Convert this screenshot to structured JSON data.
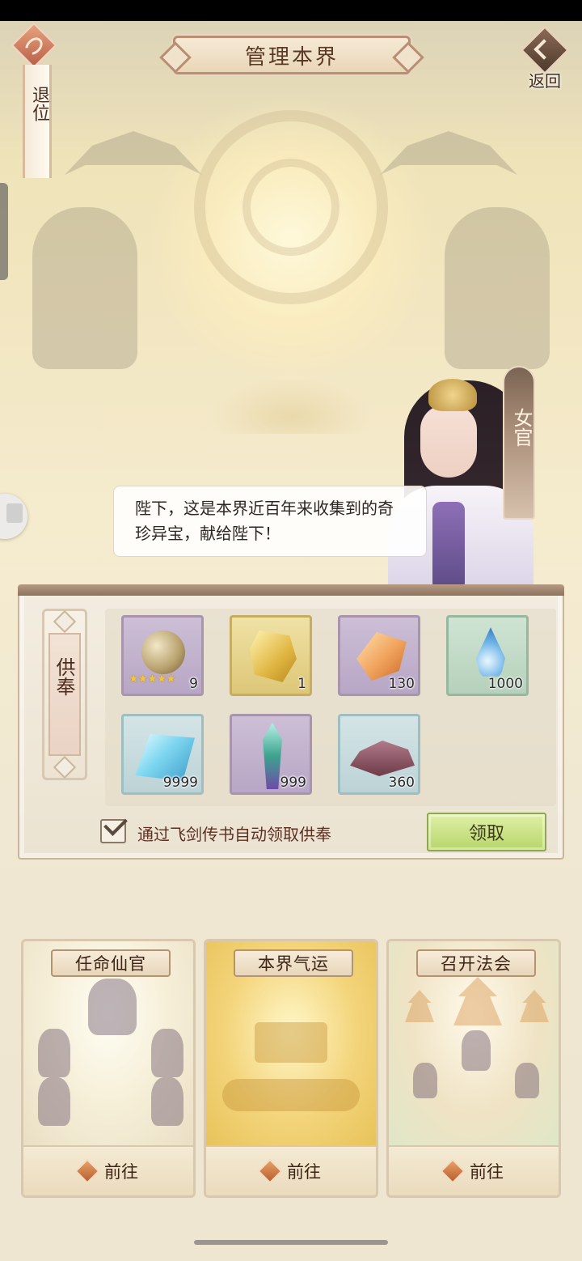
{
  "header": {
    "title": "管理本界",
    "abdicate_label": "退位",
    "back_label": "返回"
  },
  "character": {
    "badge_label": "女官",
    "dialogue": "陛下，这是本界近百年来收集到的奇珍异宝，献给陛下！"
  },
  "tribute": {
    "label": "供奉",
    "items": [
      {
        "name": "spirit-orb",
        "quantity": "9",
        "stars": "★★★★★",
        "rarity": "purple"
      },
      {
        "name": "gold-ore",
        "quantity": "1",
        "rarity": "gold"
      },
      {
        "name": "amber-stone",
        "quantity": "130",
        "rarity": "purple"
      },
      {
        "name": "water-drop",
        "quantity": "1000",
        "rarity": "green"
      },
      {
        "name": "blue-crystal",
        "quantity": "9999",
        "rarity": "blue"
      },
      {
        "name": "jade-sword",
        "quantity": "999",
        "rarity": "purple"
      },
      {
        "name": "sand-pile",
        "quantity": "360",
        "rarity": "blue"
      }
    ],
    "auto_claim_label": "通过飞剑传书自动领取供奉",
    "auto_claim_checked": true,
    "claim_button": "领取"
  },
  "cards": [
    {
      "title": "任命仙官",
      "go_label": "前往"
    },
    {
      "title": "本界气运",
      "go_label": "前往"
    },
    {
      "title": "召开法会",
      "go_label": "前往"
    }
  ],
  "colors": {
    "accent_brown": "#5b3a25",
    "claim_green": "#b8d66b",
    "go_icon_orange": "#b86030"
  }
}
